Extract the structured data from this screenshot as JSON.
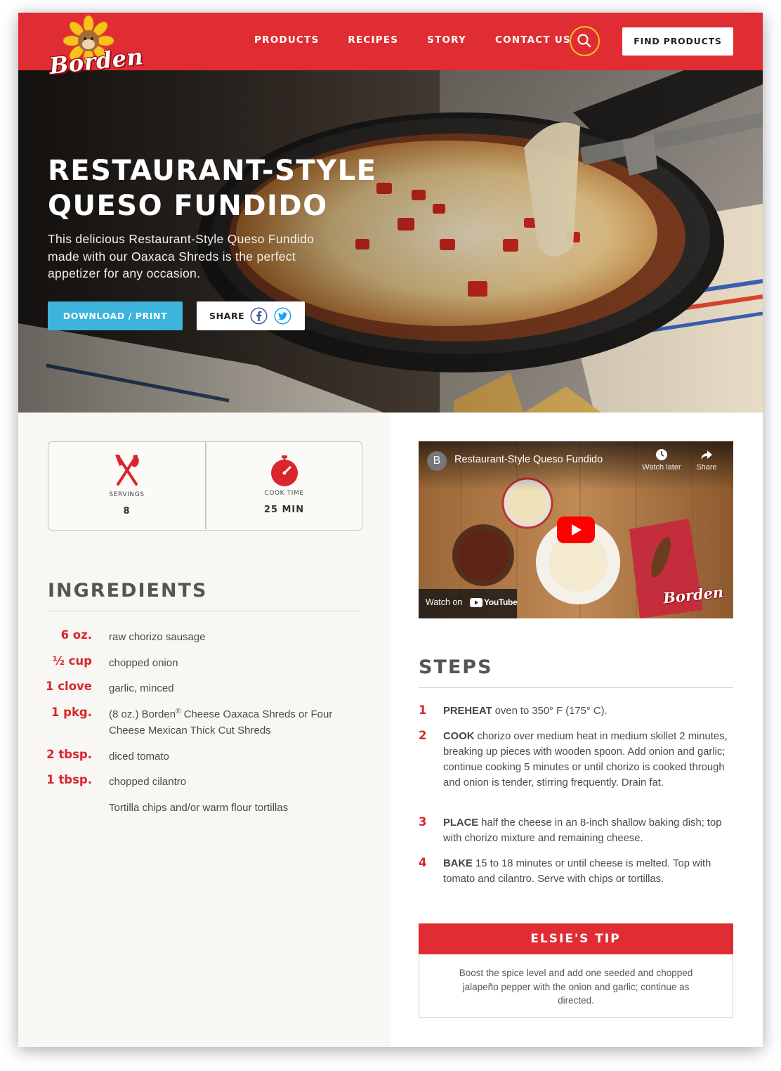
{
  "brand": {
    "name": "Borden",
    "accent": "#e02d33",
    "button_blue": "#3db4dc",
    "gold": "#f6c12b"
  },
  "nav": {
    "links": [
      "PRODUCTS",
      "RECIPES",
      "STORY",
      "CONTACT US"
    ],
    "search_icon": "search-icon",
    "find_products": "FIND PRODUCTS"
  },
  "hero": {
    "title_line1": "RESTAURANT-STYLE",
    "title_line2": "QUESO FUNDIDO",
    "description": "This delicious Restaurant-Style Queso Fundido made with our Oaxaca Shreds is the perfect appetizer for any occasion.",
    "download_label": "DOWNLOAD / PRINT",
    "share_label": "SHARE",
    "share_icons": [
      "facebook-icon",
      "twitter-icon"
    ]
  },
  "stats": {
    "servings_label": "SERVINGS",
    "servings_value": "8",
    "cook_time_label": "COOK TIME",
    "cook_time_value": "25 MIN"
  },
  "ingredients": {
    "title": "INGREDIENTS",
    "items": [
      {
        "qty": "6 oz.",
        "name": "raw chorizo sausage"
      },
      {
        "qty": "½ cup",
        "name": "chopped onion"
      },
      {
        "qty": "1 clove",
        "name": "garlic, minced"
      },
      {
        "qty": "1 pkg.",
        "name_prefix": "(8 oz.) Borden",
        "name_reg": "®",
        "name_suffix": " Cheese Oaxaca Shreds or Four Cheese Mexican Thick Cut Shreds"
      },
      {
        "qty": "2 tbsp.",
        "name": "diced tomato"
      },
      {
        "qty": "1 tbsp.",
        "name": "chopped cilantro"
      },
      {
        "qty": "",
        "name": "Tortilla chips and/or warm flour tortillas"
      }
    ]
  },
  "video": {
    "channel_initial": "B",
    "title": "Restaurant-Style Queso Fundido",
    "watch_later": "Watch later",
    "share": "Share",
    "watch_on": "Watch on",
    "youtube": "YouTube",
    "brand_watermark": "Borden"
  },
  "steps": {
    "title": "STEPS",
    "items": [
      {
        "num": "1",
        "lead": "PREHEAT",
        "text": " oven to 350° F (175° C)."
      },
      {
        "num": "2",
        "lead": "COOK",
        "text": " chorizo over medium heat in medium skillet 2 minutes, breaking up pieces with wooden spoon. Add onion and garlic; continue cooking 5 minutes or until chorizo is cooked through and onion is tender, stirring frequently. Drain fat."
      },
      {
        "num": "3",
        "lead": "PLACE",
        "text": " half the cheese in an 8-inch shallow baking dish; top with chorizo mixture and remaining cheese."
      },
      {
        "num": "4",
        "lead": "BAKE",
        "text": " 15 to 18 minutes or until cheese is melted. Top with tomato and cilantro. Serve with chips or tortillas."
      }
    ]
  },
  "tip": {
    "title": "ELSIE'S TIP",
    "text": "Boost the spice level and add one seeded and chopped jalapeño pepper with the onion and garlic; continue as directed."
  }
}
